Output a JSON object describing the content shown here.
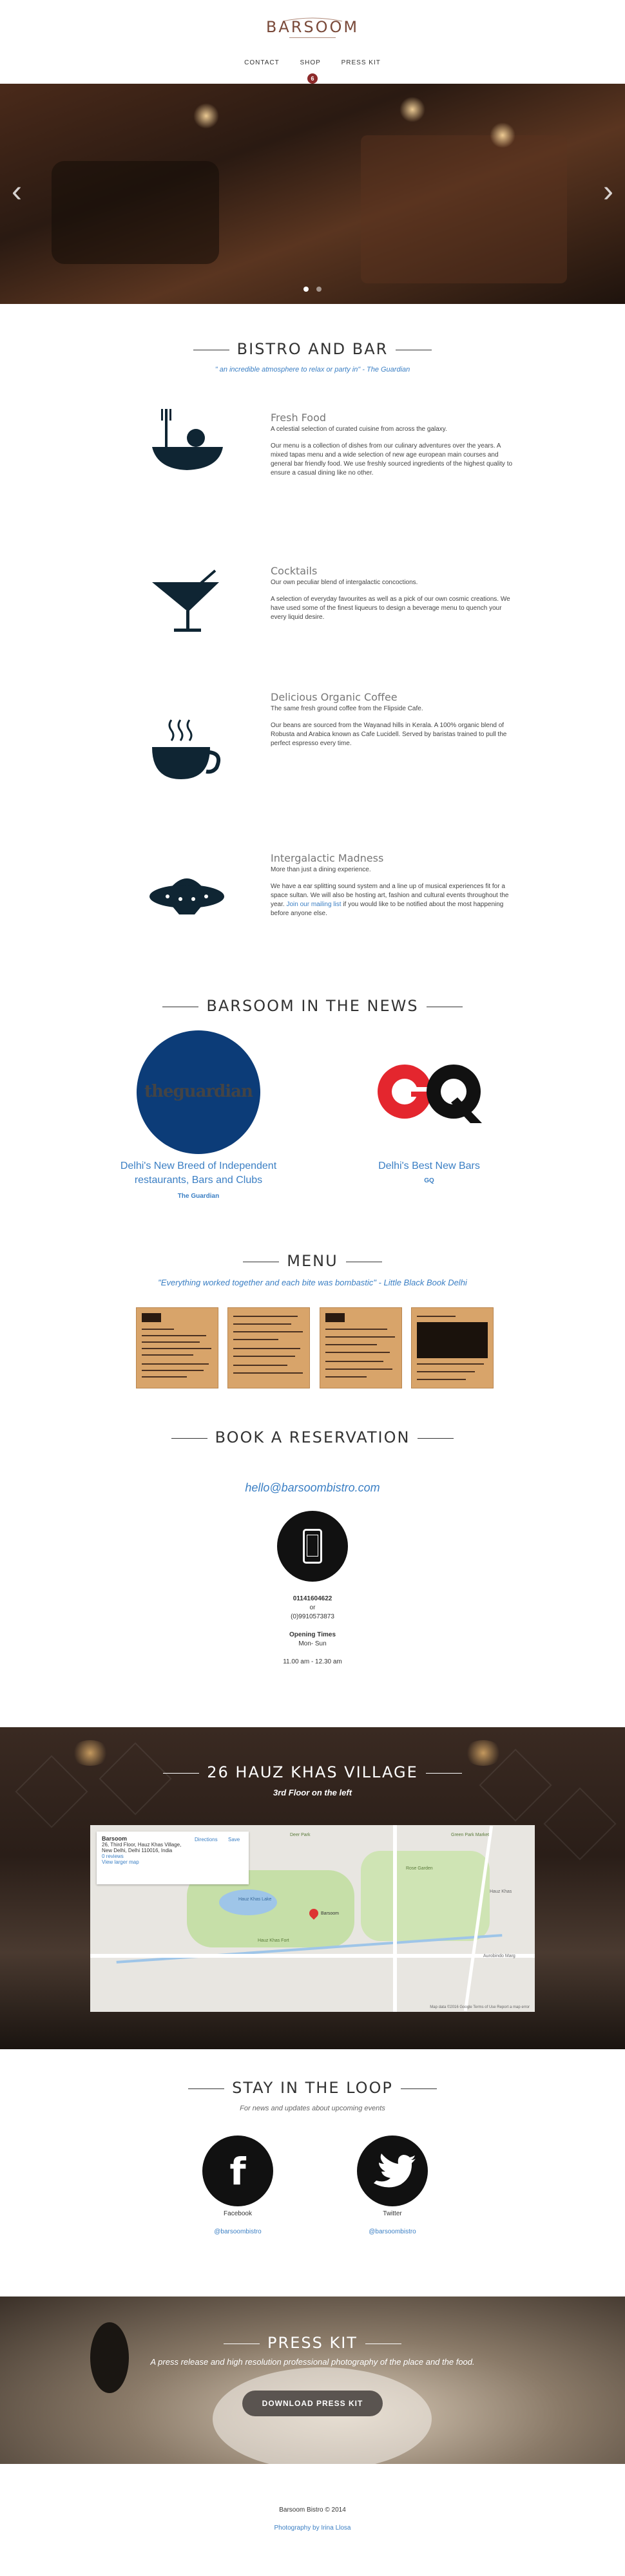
{
  "header": {
    "logo": "BARSOOM",
    "nav": [
      "CONTACT",
      "SHOP",
      "PRESS KIT"
    ],
    "badge": "6"
  },
  "hero": {
    "prev": "‹",
    "next": "›"
  },
  "bistro": {
    "title": "BISTRO AND BAR",
    "quote": "\" an incredible atmosphere to relax or party in\" - The Guardian",
    "features": [
      {
        "icon": "food-bowl-icon",
        "title": "Fresh Food",
        "lead": "A celestial selection of curated cuisine from across the galaxy.",
        "body": "Our menu is a collection of dishes from our culinary adventures over the years. A mixed tapas menu and a wide selection of new age european main courses and general bar friendly food. We use freshly sourced ingredients of the highest quality to ensure a casual dining like no other."
      },
      {
        "icon": "cocktail-glass-icon",
        "title": "Cocktails",
        "lead": "Our own peculiar blend of intergalactic concoctions.",
        "body": "A selection of everyday favourites as well as a pick of our own cosmic creations. We have used some of the finest liqueurs to design a beverage menu to quench your every liquid desire."
      },
      {
        "icon": "coffee-cup-icon",
        "title": "Delicious Organic Coffee",
        "lead": "The same fresh ground coffee from the Flipside Cafe.",
        "body": "Our beans are sourced from the Wayanad hills in Kerala. A 100% organic blend of Robusta and Arabica known as Cafe Lucidell. Served by baristas trained to pull the perfect espresso every time."
      },
      {
        "icon": "ufo-icon",
        "title": "Intergalactic Madness",
        "lead": "More than just a dining experience.",
        "body_a": "We have a ear splitting sound system and a line up of musical experiences fit for a space sultan. We will also be hosting art, fashion and cultural events throughout the year.",
        "body_link": "Join our mailing list",
        "body_b": "if you would like to be notified about the most happening before anyone else."
      }
    ]
  },
  "news": {
    "title": "BARSOOM IN THE NEWS",
    "items": [
      {
        "logo": "theguardian",
        "headline": "Delhi's New Breed of Independent restaurants, Bars and Clubs",
        "source": "The Guardian"
      },
      {
        "logo": "GQ",
        "headline": "Delhi's Best New Bars",
        "source": "GQ"
      }
    ]
  },
  "menu": {
    "title": "MENU",
    "quote": "\"Everything worked together and each bite was bombastic\" - Little Black Book Delhi"
  },
  "reservation": {
    "title": "BOOK A RESERVATION",
    "email": "hello@barsoombistro.com",
    "phone1": "01141604622",
    "or": "or",
    "phone2": "(0)9910573873",
    "hours_label": "Opening Times",
    "days": "Mon- Sun",
    "hours": "11.00 am - 12.30 am"
  },
  "address": {
    "title": "26 HAUZ KHAS VILLAGE",
    "floor": "3rd Floor on the left",
    "map": {
      "place": "Barsoom",
      "addr1": "26, Third Floor, Hauz Khas Village,",
      "addr2": "New Delhi, Delhi 110016, India",
      "reviews": "0 reviews",
      "larger": "View larger map",
      "directions": "Directions",
      "save": "Save",
      "labels": [
        "Deer Park",
        "Hauz Khas Lake",
        "Hauz Khas Fort",
        "Green Park Market",
        "Rose Garden",
        "Barsoom",
        "Aurobindo Marg",
        "Hauz Khas"
      ],
      "foot": "Map data ©2016 Google   Terms of Use   Report a map error"
    }
  },
  "loop": {
    "title": "STAY IN THE LOOP",
    "sub": "For news and updates about upcoming events",
    "social": [
      {
        "icon": "facebook-icon",
        "glyph": "f",
        "name": "Facebook",
        "handle": "@barsoombistro"
      },
      {
        "icon": "twitter-icon",
        "glyph": "t",
        "name": "Twitter",
        "handle": "@barsoombistro"
      }
    ]
  },
  "press": {
    "title": "PRESS KIT",
    "sub": "A press release and high resolution professional photography of the place and the food.",
    "button": "DOWNLOAD PRESS KIT"
  },
  "footer": {
    "copyright": "Barsoom Bistro © 2014",
    "photo": "Photography by Irina Llosa"
  }
}
